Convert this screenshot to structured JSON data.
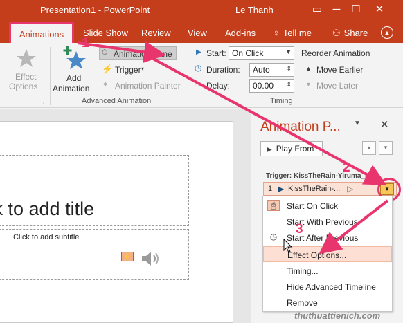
{
  "titlebar": {
    "title": "Presentation1 - PowerPoint",
    "user": "Le Thanh",
    "minimize": "─",
    "restore": "☐",
    "close": "✕"
  },
  "tabs": {
    "animations": "Animations",
    "slideshow": "Slide Show",
    "review": "Review",
    "view": "View",
    "addins": "Add-ins",
    "tellme": "Tell me",
    "share": "Share"
  },
  "ribbon": {
    "effect_options": "Effect Options",
    "effect_options_line1": "Effect",
    "effect_options_line2": "Options",
    "add_animation_line1": "Add",
    "add_animation_line2": "Animation",
    "animation_pane": "Animation Pane",
    "trigger": "Trigger",
    "animation_painter": "Animation Painter",
    "advanced_animation": "Advanced Animation",
    "start_label": "Start:",
    "start_value": "On Click",
    "duration_label": "Duration:",
    "duration_value": "Auto",
    "delay_label": "Delay:",
    "delay_value": "00.00",
    "timing": "Timing",
    "reorder_animation": "Reorder Animation",
    "move_earlier": "Move Earlier",
    "move_later": "Move Later"
  },
  "slide": {
    "title_placeholder": "ck to add title",
    "subtitle_placeholder": "Click to add subtitle"
  },
  "pane": {
    "title": "Animation P...",
    "play_from": "Play From",
    "trigger_label": "Trigger: KissTheRain-Yiruma_b...",
    "item_number": "1",
    "item_name": "KissTheRain-..."
  },
  "context_menu": {
    "items": [
      {
        "label": "Start On Click"
      },
      {
        "label": "Start With Previous"
      },
      {
        "label": "Start After Previous"
      },
      {
        "label": "Effect Options..."
      },
      {
        "label": "Timing..."
      },
      {
        "label": "Hide Advanced Timeline"
      },
      {
        "label": "Remove"
      }
    ]
  },
  "annotations": {
    "step1": "1",
    "step2": "2",
    "step3": "3",
    "watermark": "thuthuattienich.com"
  },
  "colors": {
    "accent": "#c43e1c",
    "highlight": "#e8356d"
  }
}
